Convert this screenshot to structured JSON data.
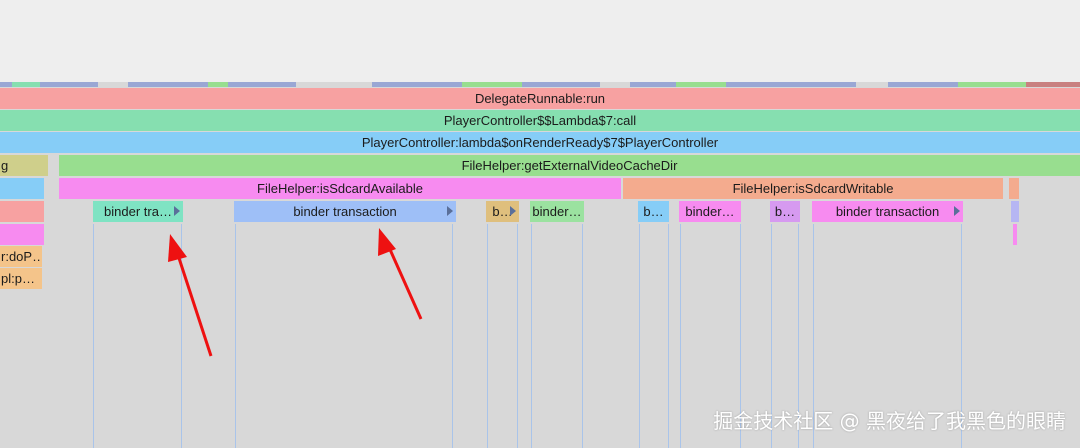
{
  "colors": {
    "delegate": "#f7a1a1",
    "lambda_call": "#86dfb0",
    "render_ready": "#86cdf7",
    "external_cache": "#98de8f",
    "sdcard_available": "#f78bf0",
    "sdcard_writable": "#f4ab8e",
    "binder_green": "#7fe3c3",
    "binder_blue": "#9ebff7",
    "binder_tan": "#dfbf7d",
    "binder_lightgreen": "#9be2a0",
    "binder_sky": "#86cdf7",
    "binder_pink": "#f78bf0",
    "binder_violet": "#d69af0",
    "arrow_red": "#ee1111"
  },
  "slices": {
    "delegate_runnable": "DelegateRunnable:run",
    "player_lambda_call": "PlayerController$$Lambda$7:call",
    "player_render_ready": "PlayerController:lambda$onRenderReady$7$PlayerController",
    "external_cache_dir": "FileHelper:getExternalVideoCacheDir",
    "left_g": "g",
    "sdcard_available": "FileHelper:isSdcardAvailable",
    "sdcard_writable": "FileHelper:isSdcardWritable",
    "left_dop": "r:doP…",
    "left_pl": "pl:p…"
  },
  "binders": {
    "b1": "binder tra…",
    "b2": "binder transaction",
    "b3": "b…",
    "b4": "binder…",
    "b5": "b…",
    "b6": "binder…",
    "b7": "b…",
    "b8": "binder transaction"
  },
  "watermark": "掘金技术社区 @ 黑夜给了我黑色的眼睛"
}
